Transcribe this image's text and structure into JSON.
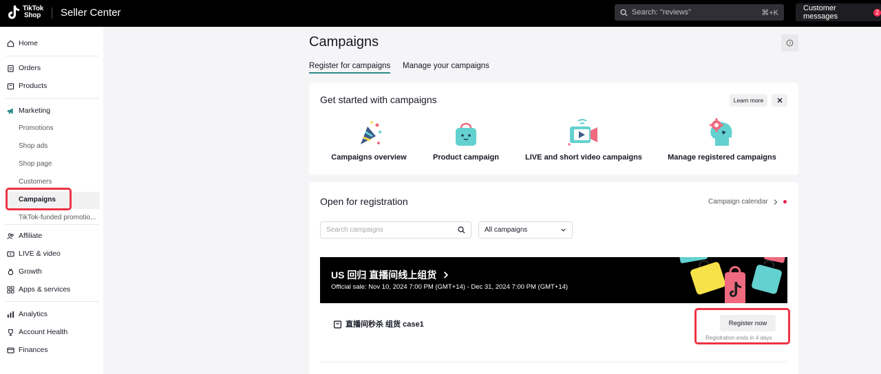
{
  "topbar": {
    "logo_line1": "TikTok",
    "logo_line2": "Shop",
    "app_title": "Seller Center",
    "search_placeholder": "Search: \"reviews\"",
    "search_shortcut": "⌘+K",
    "customer_messages_label": "Customer messages",
    "customer_messages_count": "2"
  },
  "sidebar": {
    "home": "Home",
    "orders": "Orders",
    "products": "Products",
    "marketing": "Marketing",
    "promotions": "Promotions",
    "shop_ads": "Shop ads",
    "shop_page": "Shop page",
    "customers": "Customers",
    "campaigns": "Campaigns",
    "tiktok_funded": "TikTok-funded promotio...",
    "affiliate": "Affiliate",
    "live_video": "LIVE & video",
    "growth": "Growth",
    "apps_services": "Apps & services",
    "analytics": "Analytics",
    "account_health": "Account Health",
    "finances": "Finances"
  },
  "main": {
    "title": "Campaigns",
    "tabs": [
      {
        "label": "Register for campaigns",
        "active": true
      },
      {
        "label": "Manage your campaigns",
        "active": false
      }
    ],
    "get_started": {
      "title": "Get started with campaigns",
      "learn_more": "Learn more",
      "features": [
        {
          "label": "Campaigns overview",
          "icon": "party-popper-icon"
        },
        {
          "label": "Product campaign",
          "icon": "shopping-bag-icon"
        },
        {
          "label": "LIVE and short video campaigns",
          "icon": "video-camera-icon"
        },
        {
          "label": "Manage registered campaigns",
          "icon": "head-gear-icon"
        }
      ]
    },
    "open_registration": {
      "title": "Open for registration",
      "calendar_link": "Campaign calendar",
      "search_placeholder": "Search campaigns",
      "filter_value": "All campaigns",
      "banner_title": "US 回归 直播间线上组货",
      "banner_subtitle": "Official sale: Nov 10, 2024 7:00 PM (GMT+14) - Dec 31, 2024 7:00 PM (GMT+14)",
      "campaign_name": "直播间秒杀 组货 case1",
      "register_button": "Register now",
      "registration_note": "Registration ends in 4 days"
    }
  },
  "colors": {
    "accent_teal": "#2c8a86",
    "highlight_red": "#ee3344",
    "brand_pink": "#fe2c55"
  }
}
